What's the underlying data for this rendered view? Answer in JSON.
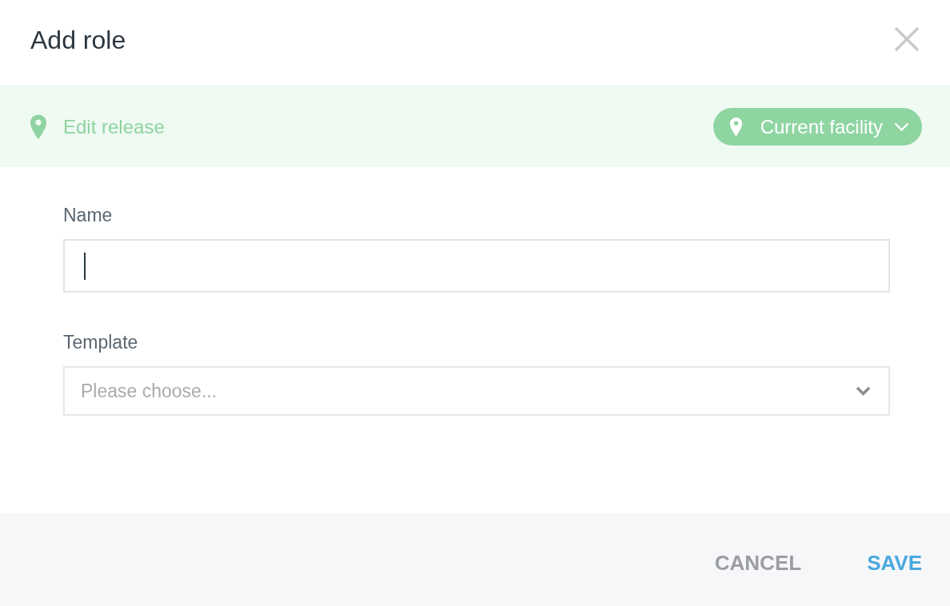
{
  "dialog": {
    "title": "Add role"
  },
  "context_bar": {
    "label": "Edit release",
    "scope_button": {
      "label": "Current facility"
    }
  },
  "form": {
    "fields": [
      {
        "kind": "text",
        "label": "Name",
        "focused": true
      },
      {
        "kind": "select",
        "label": "Template",
        "placeholder": "Please choose..."
      }
    ]
  },
  "footer": {
    "buttons": [
      {
        "label": "CANCEL",
        "kind": "secondary"
      },
      {
        "label": "SAVE",
        "kind": "primary"
      }
    ]
  }
}
